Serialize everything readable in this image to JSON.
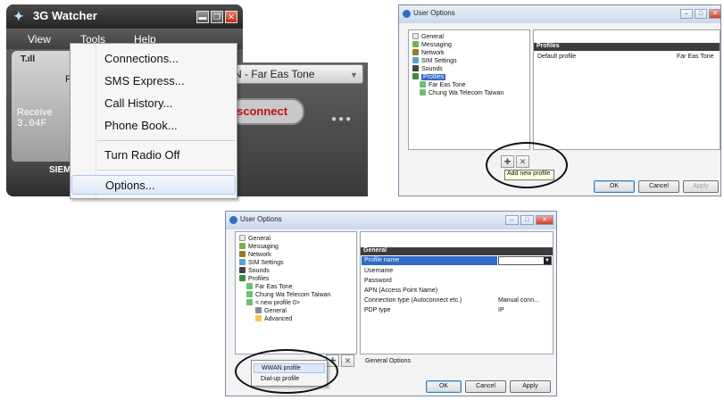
{
  "watcher": {
    "title": "3G Watcher",
    "menubar": [
      "View",
      "Tools",
      "Help"
    ],
    "signal_text": "T.ıll",
    "partial_letter": "F",
    "received_label": "Receive",
    "received_value": "3.04F",
    "network_combo": "N - Far Eas Tone",
    "connect_button": "sconnect",
    "brand": "SIEM",
    "tools_menu": {
      "items": [
        "Connections...",
        "SMS Express...",
        "Call History...",
        "Phone Book...",
        "Turn Radio Off",
        "Options..."
      ],
      "highlighted": "Options..."
    }
  },
  "dialog1": {
    "title": "User Options",
    "tree": [
      "General",
      "Messaging",
      "Network",
      "SIM Settings",
      "Sounds",
      "Profiles",
      "Far Eas Tone",
      "Chung Wa Telecom Taiwan"
    ],
    "selected": "Profiles",
    "grid_header": "Profiles",
    "grid_row": {
      "name": "Default profile",
      "value": "Far Eas Tone"
    },
    "tooltip": "Add new profile",
    "buttons": {
      "ok": "OK",
      "cancel": "Cancel",
      "apply": "Apply"
    }
  },
  "dialog2": {
    "title": "User Options",
    "tree": [
      "General",
      "Messaging",
      "Network",
      "SIM Settings",
      "Sounds",
      "Profiles",
      "Far Eas Tone",
      "Chung Wa Telecom Taiwan",
      "< new profile 0>",
      "General",
      "Advanced"
    ],
    "grid_header": "General",
    "selected_field": "Profile name",
    "fields": [
      {
        "label": "Username",
        "value": ""
      },
      {
        "label": "Password",
        "value": ""
      },
      {
        "label": "APN (Access Point Name)",
        "value": ""
      },
      {
        "label": "Connection type (Autoconnect etc.)",
        "value": "Manual conn..."
      },
      {
        "label": "PDP type",
        "value": "IP"
      }
    ],
    "section_label": "General Options",
    "popup_items": [
      "WWAN profile",
      "Dial-up profile"
    ],
    "buttons": {
      "ok": "OK",
      "cancel": "Cancel",
      "apply": "Apply"
    }
  }
}
